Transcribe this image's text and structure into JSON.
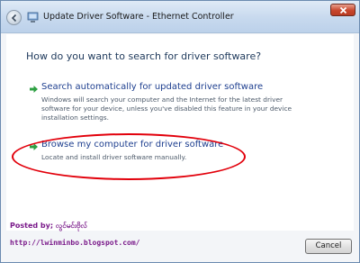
{
  "window": {
    "title": "Update Driver Software - Ethernet Controller"
  },
  "main": {
    "heading": "How do you want to search for driver software?",
    "options": [
      {
        "title": "Search automatically for updated driver software",
        "description": "Windows will search your computer and the Internet for the latest driver software for your device, unless you've disabled this feature in your device installation settings.",
        "icon": "green-arrow-icon"
      },
      {
        "title": "Browse my computer for driver software",
        "description": "Locate and install driver software manually.",
        "icon": "green-arrow-icon"
      }
    ]
  },
  "footer": {
    "posted_by": "Posted by; လွင်မင်းဗိုလ်",
    "blog_url": "http://lwinminbo.blogspot.com/",
    "cancel_label": "Cancel"
  },
  "colors": {
    "highlight": "#e2000b",
    "link": "#1e3f8f",
    "accent_text": "#7a1a8a"
  }
}
